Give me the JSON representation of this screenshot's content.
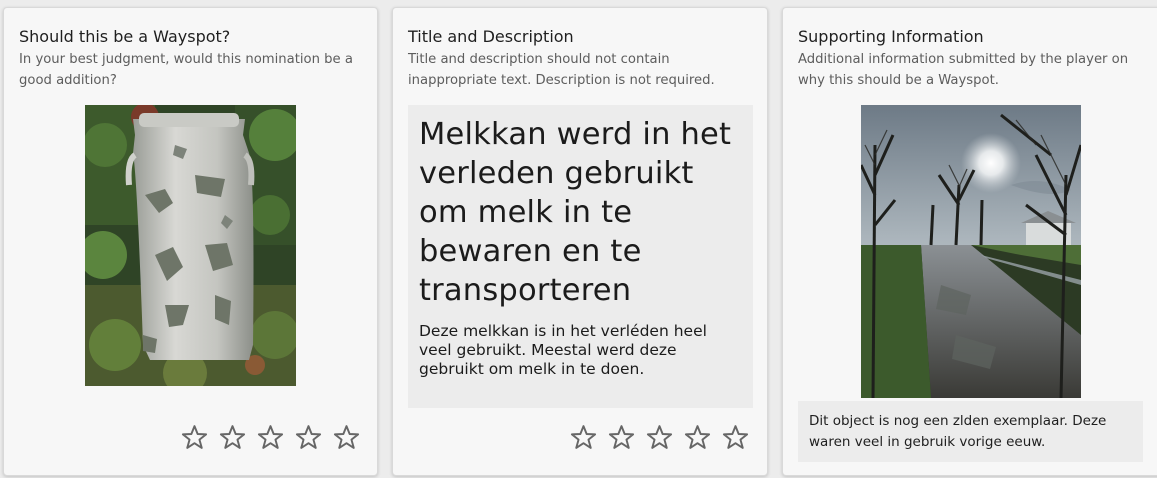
{
  "wayspot_card": {
    "title": "Should this be a Wayspot?",
    "subtitle": "In your best judgment, would this nomination be a good addition?",
    "photo_icon": "milk-can-photo",
    "rating": {
      "max": 5,
      "value": 0
    }
  },
  "title_description_card": {
    "title": "Title and Description",
    "subtitle": "Title and description should not contain inappropriate text. Description is not required.",
    "nomination_title": "Melkkan werd in het verleden gebruikt om melk in te bewaren en te transporteren",
    "nomination_description": "Deze melkkan is in het verléden heel veel gebruikt. Meestal werd deze gebruikt om melk in te doen.",
    "rating": {
      "max": 5,
      "value": 0
    }
  },
  "supporting_card": {
    "title": "Supporting Information",
    "subtitle": "Additional information submitted by the player on why this should be a Wayspot.",
    "photo_icon": "country-road-photo",
    "supporting_text": "Dit object is nog een zlden exemplaar. Deze waren veel in gebruik vorige eeuw."
  },
  "colors": {
    "card_bg": "#f7f7f7",
    "page_bg": "#ececec",
    "text_box_bg": "#ececec",
    "star_stroke": "#666666"
  }
}
